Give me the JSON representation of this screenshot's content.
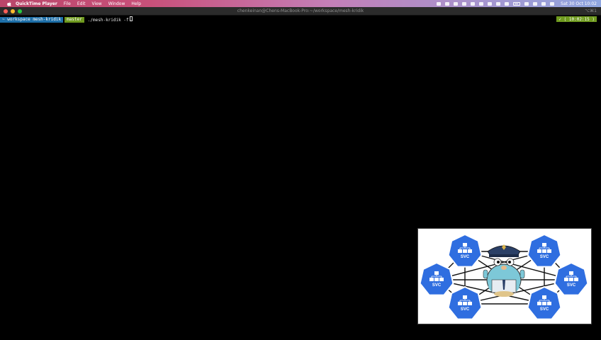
{
  "menubar": {
    "app_name": "QuickTime Player",
    "items": [
      "File",
      "Edit",
      "View",
      "Window",
      "Help"
    ],
    "clock": "Sat 30 Oct  10:02"
  },
  "terminal": {
    "window_title": "chenkeinan@Chens-MacBook-Pro:~/workspace/mesh-kridik",
    "shortcut": "⌥⌘1",
    "prompt_path": "~ workspace mesh-kridik",
    "prompt_git": "master",
    "command": "./mesh-kridik -f",
    "right_status": "✓ ⟨ 10:02:15 ⟩"
  },
  "overlay": {
    "svc_label": "SVC",
    "colors": {
      "svc": "#2f6ee0",
      "gopher": "#7dc8d8",
      "hat": "#2a3f66"
    }
  }
}
